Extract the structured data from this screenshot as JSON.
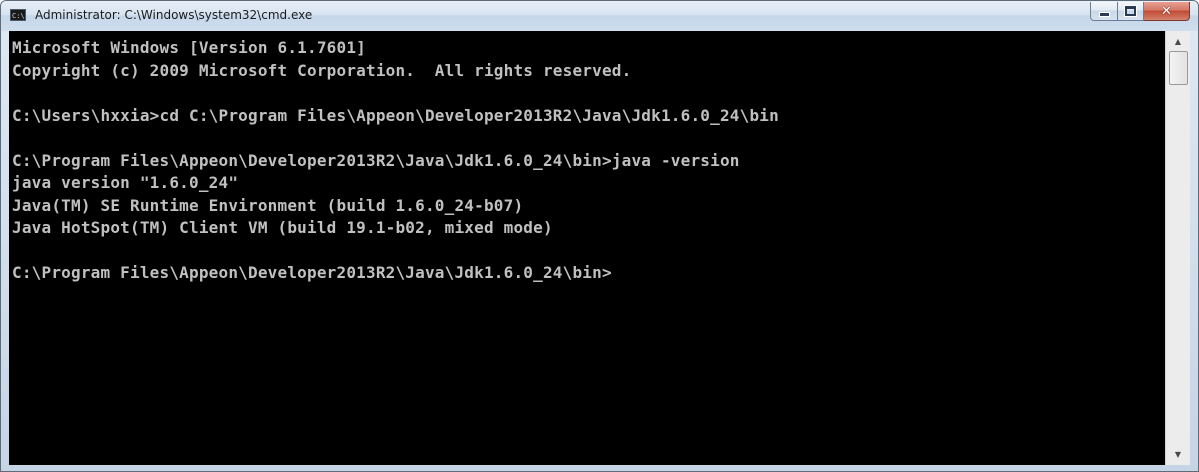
{
  "window": {
    "title": "Administrator: C:\\Windows\\system32\\cmd.exe",
    "app_icon": "cmd-app-icon",
    "app_icon_text": "C:\\",
    "caption_buttons": {
      "minimize_icon": "minimize-icon",
      "maximize_icon": "maximize-icon",
      "close_icon": "close-icon",
      "close_glyph": "✕",
      "close_color": "#c24a34"
    }
  },
  "console": {
    "background_color": "#000000",
    "text_color": "#c0c0c0",
    "lines": [
      "Microsoft Windows [Version 6.1.7601]",
      "Copyright (c) 2009 Microsoft Corporation.  All rights reserved.",
      "",
      "C:\\Users\\hxxia>cd C:\\Program Files\\Appeon\\Developer2013R2\\Java\\Jdk1.6.0_24\\bin",
      "",
      "C:\\Program Files\\Appeon\\Developer2013R2\\Java\\Jdk1.6.0_24\\bin>java -version",
      "java version \"1.6.0_24\"",
      "Java(TM) SE Runtime Environment (build 1.6.0_24-b07)",
      "Java HotSpot(TM) Client VM (build 19.1-b02, mixed mode)",
      "",
      "C:\\Program Files\\Appeon\\Developer2013R2\\Java\\Jdk1.6.0_24\\bin>"
    ]
  },
  "scrollbar": {
    "up_arrow_glyph": "▲",
    "down_arrow_glyph": "▼",
    "up_icon": "scroll-up-arrow-icon",
    "down_icon": "scroll-down-arrow-icon"
  }
}
